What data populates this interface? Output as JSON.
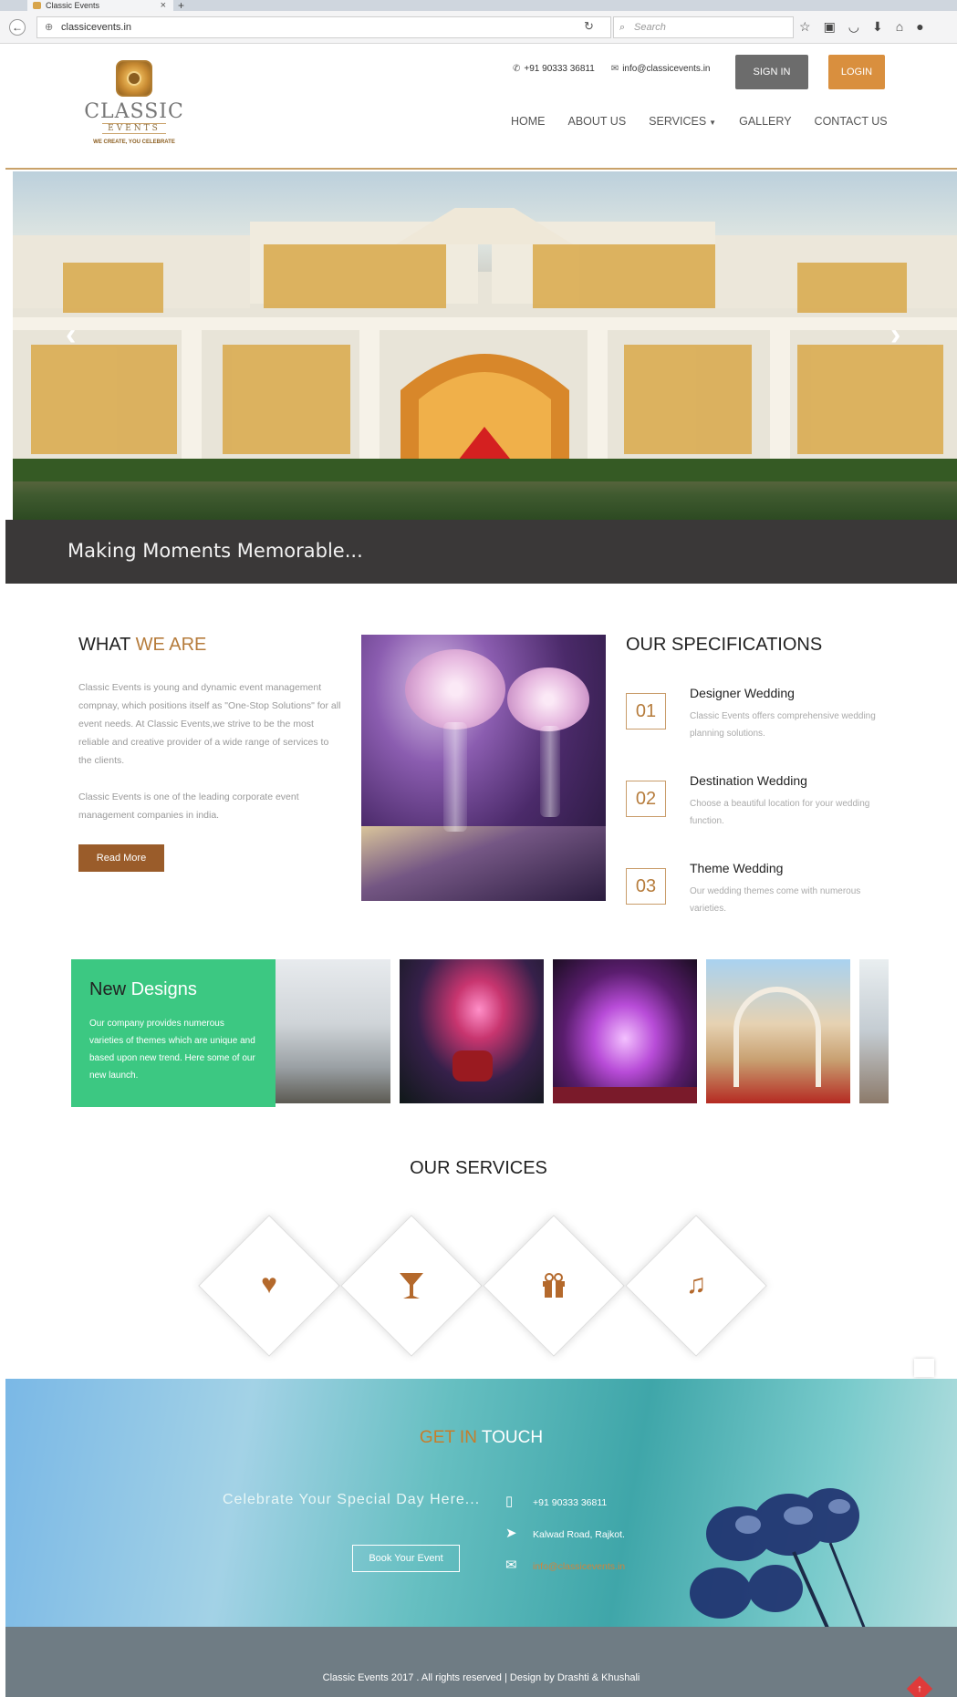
{
  "browser": {
    "tab_title": "Classic Events",
    "tab_close": "×",
    "new_tab": "+",
    "url": "classicevents.in",
    "search_placeholder": "Search",
    "toolbar_icons": [
      "star-icon",
      "reading-list-icon",
      "pocket-icon",
      "download-icon",
      "home-icon",
      "chat-icon"
    ]
  },
  "header": {
    "logo_word": "CLASSIC",
    "logo_sub": "EVENTS",
    "logo_tagline": "WE CREATE, YOU CELEBRATE",
    "phone": "+91 90333 36811",
    "email": "info@classicevents.in",
    "sign_in": "SIGN IN",
    "login": "LOGIN",
    "nav": [
      "HOME",
      "ABOUT US",
      "SERVICES",
      "GALLERY",
      "CONTACT US"
    ]
  },
  "hero": {
    "prev": "‹",
    "next": "›",
    "tagline": "Making Moments Memorable..."
  },
  "about": {
    "title_main": "WHAT ",
    "title_accent": "WE ARE",
    "para1": "Classic Events is young and dynamic event management compnay, which positions itself as \"One-Stop Solutions\" for all event needs. At Classic Events,we strive to be the most reliable and creative provider of a wide range of services to the clients.",
    "para2": "Classic Events is one of the leading corporate event management companies in india.",
    "read_more": "Read More"
  },
  "specifications": {
    "title": "OUR SPECIFICATIONS",
    "items": [
      {
        "num": "01",
        "head": "Designer Wedding",
        "desc": "Classic Events offers comprehensive wedding planning solutions."
      },
      {
        "num": "02",
        "head": "Destination Wedding",
        "desc": "Choose a beautiful location for your wedding function."
      },
      {
        "num": "03",
        "head": "Theme Wedding",
        "desc": "Our wedding themes come with numerous varieties."
      }
    ]
  },
  "new_designs": {
    "title_first": "New ",
    "title_second": "Designs",
    "text": "Our company provides numerous varieties of themes which are unique and based upon new trend. Here some of our new launch."
  },
  "services": {
    "title": "OUR SERVICES",
    "icons": [
      "heart-icon",
      "cocktail-icon",
      "gift-icon",
      "music-icon"
    ]
  },
  "touch": {
    "title_accent": "GET IN",
    "title_main": " TOUCH",
    "celebrate": "Celebrate Your Special Day Here...",
    "book": "Book Your Event",
    "phone": "+91 90333 36811",
    "address": "Kalwad Road, Rajkot.",
    "email": "info@classicevents.in"
  },
  "footer": {
    "text": "Classic Events 2017 . All rights reserved | Design by Drashti & Khushali"
  },
  "colors": {
    "accent": "#b67c3c",
    "login": "#d98f3e",
    "signin": "#6c6c6c",
    "green": "#3cc882",
    "tagline_bar": "#3a3838"
  }
}
